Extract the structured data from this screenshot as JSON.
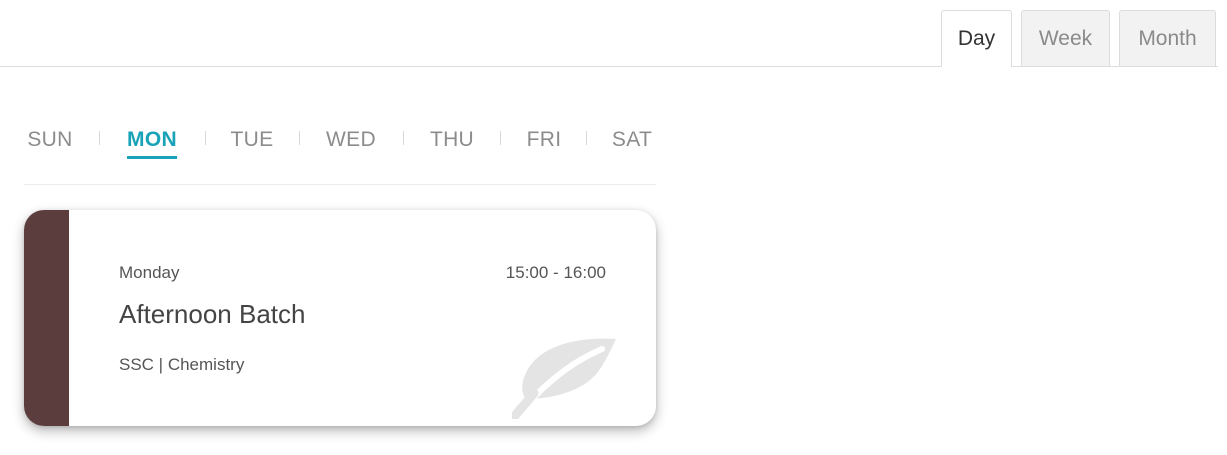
{
  "view_tabs": [
    {
      "label": "Day",
      "active": true
    },
    {
      "label": "Week",
      "active": false
    },
    {
      "label": "Month",
      "active": false
    }
  ],
  "days": [
    {
      "label": "SUN",
      "active": false
    },
    {
      "label": "MON",
      "active": true
    },
    {
      "label": "TUE",
      "active": false
    },
    {
      "label": "WED",
      "active": false
    },
    {
      "label": "THU",
      "active": false
    },
    {
      "label": "FRI",
      "active": false
    },
    {
      "label": "SAT",
      "active": false
    }
  ],
  "batch_card": {
    "day": "Monday",
    "time": "15:00 - 16:00",
    "title": "Afternoon Batch",
    "subject": "SSC | Chemistry",
    "icon": "leaf-icon",
    "accent_color": "#5c3d3d"
  },
  "colors": {
    "active_day": "#1aa3b8",
    "inactive_text": "#8c8c8c"
  }
}
